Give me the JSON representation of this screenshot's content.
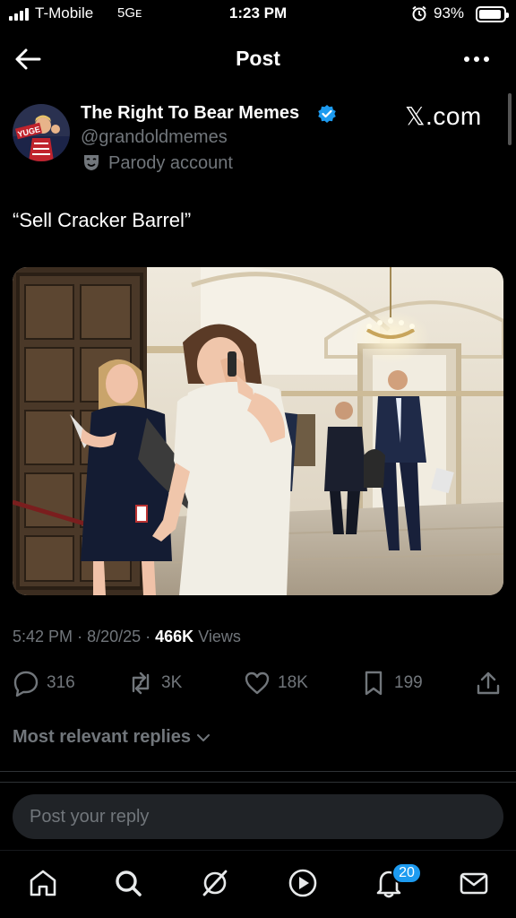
{
  "status_bar": {
    "carrier": "T-Mobile",
    "network": "5Gᴇ",
    "time": "1:23 PM",
    "battery": "93%",
    "battery_level": 0.93
  },
  "header": {
    "title": "Post",
    "back_icon": "arrow-left-icon",
    "more_icon": "more-horizontal-icon"
  },
  "author": {
    "name": "The Right To Bear Memes",
    "handle": "@grandoldmemes",
    "badge": "Parody account",
    "avatar_text": "YUGE",
    "verified_color": "#1d9bf0"
  },
  "brand": "𝕏.com",
  "tweet": {
    "text": "“Sell Cracker Barrel”"
  },
  "meta": {
    "time": "5:42 PM",
    "date": "8/20/25",
    "views_count": "466K",
    "views_label": "Views"
  },
  "actions": {
    "replies": "316",
    "reposts": "3K",
    "likes": "18K",
    "bookmarks": "199"
  },
  "replies": {
    "sort_label": "Most relevant replies",
    "placeholder": "Post your reply"
  },
  "nav": {
    "items": [
      "home-icon",
      "search-icon",
      "grok-icon",
      "video-icon",
      "notifications-icon",
      "messages-icon"
    ],
    "notifications_badge": "20"
  },
  "colors": {
    "accent": "#1d9bf0",
    "muted": "#71767b",
    "background": "#000000"
  }
}
